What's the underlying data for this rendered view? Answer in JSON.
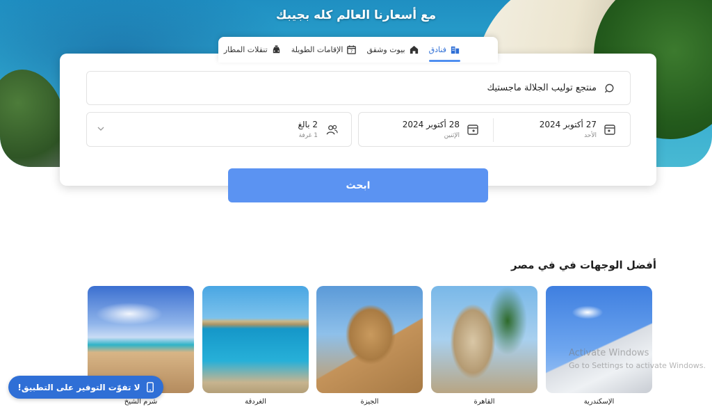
{
  "hero": {
    "title": "مع أسعارنا العالم كله بجيبك"
  },
  "tabs": [
    {
      "label": "فنادق",
      "icon": "hotel-icon",
      "active": true
    },
    {
      "label": "بيوت وشقق",
      "icon": "home-icon",
      "active": false
    },
    {
      "label": "الإقامات الطويلة",
      "icon": "calendar-stay-icon",
      "active": false
    },
    {
      "label": "تنقلات المطار",
      "icon": "taxi-icon",
      "active": false
    }
  ],
  "search": {
    "destination": "منتجع توليب الجلالة ماجستيك",
    "checkin": {
      "date": "27 أكتوبر 2024",
      "weekday": "الأحد"
    },
    "checkout": {
      "date": "28 أكتوبر 2024",
      "weekday": "الإثنين"
    },
    "guests": {
      "adults": "2 بالغ",
      "rooms": "1 غرفة"
    },
    "button_label": "ابحث"
  },
  "section": {
    "title": "أفضل الوجهات في في مصر",
    "destinations": [
      {
        "name": "الإسكندرية",
        "image": "img-alex"
      },
      {
        "name": "القاهرة",
        "image": "img-cairo"
      },
      {
        "name": "الجيزة",
        "image": "img-giza"
      },
      {
        "name": "الغردقة",
        "image": "img-hurghada"
      },
      {
        "name": "شرم الشيخ",
        "image": "img-sharm"
      }
    ]
  },
  "app_banner": {
    "label": "لا تفوّت التوفير على التطبيق!",
    "icon": "phone-icon"
  },
  "watermark": {
    "line1": "Activate Windows",
    "line2": "Go to Settings to activate Windows."
  },
  "colors": {
    "accent": "#2f6fd6",
    "button": "#5b93f2"
  }
}
